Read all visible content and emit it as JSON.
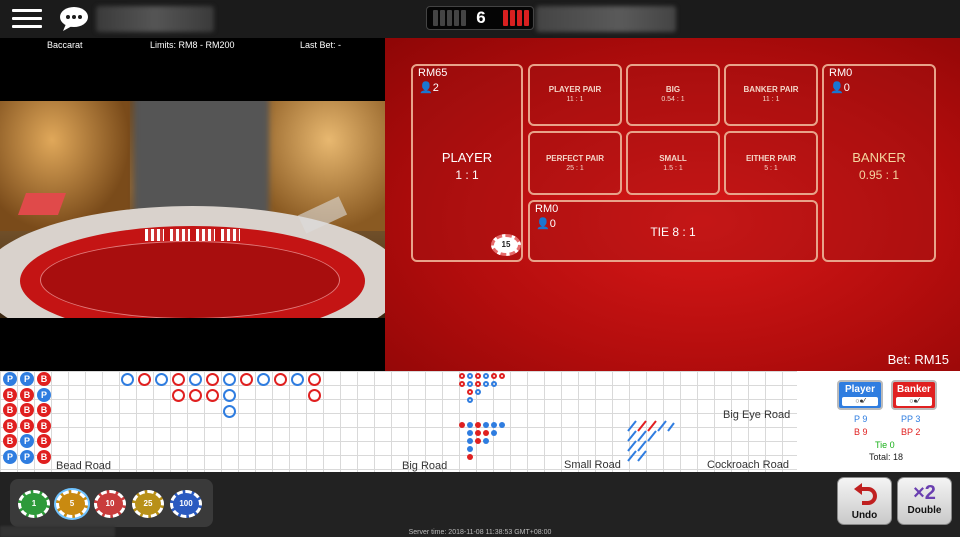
{
  "header": {
    "menu_icon": "hamburger-menu-icon",
    "chat_icon": "chat-bubble-icon",
    "shoe_count": "6"
  },
  "video": {
    "game_name": "Baccarat",
    "limits": "Limits: RM8 - RM200",
    "last_bet": "Last Bet: -"
  },
  "bet_table": {
    "player": {
      "amount": "RM65",
      "players": "2",
      "label": "PLAYER",
      "odds": "1 : 1",
      "chip": "15"
    },
    "banker": {
      "amount": "RM0",
      "players": "0",
      "label": "BANKER",
      "odds": "0.95 : 1"
    },
    "tie": {
      "amount": "RM0",
      "players": "0",
      "label": "TIE 8 : 1"
    },
    "side_bets": [
      {
        "label": "PLAYER PAIR",
        "odds": "11 : 1"
      },
      {
        "label": "BIG",
        "odds": "0.54 : 1"
      },
      {
        "label": "BANKER PAIR",
        "odds": "11 : 1"
      },
      {
        "label": "PERFECT PAIR",
        "odds": "25 : 1"
      },
      {
        "label": "SMALL",
        "odds": "1.5 : 1"
      },
      {
        "label": "EITHER PAIR",
        "odds": "5 : 1"
      }
    ],
    "bet_total": "Bet: RM15"
  },
  "roads": {
    "bead_label": "Bead Road",
    "big_label": "Big Road",
    "small_label": "Small Road",
    "big_eye_label": "Big Eye Road",
    "cockroach_label": "Cockroach Road",
    "bead_columns": [
      [
        "P",
        "B",
        "B",
        "B",
        "B",
        "P"
      ],
      [
        "P",
        "B",
        "B",
        "B",
        "P",
        "P"
      ],
      [
        "B",
        "P",
        "B",
        "B",
        "B",
        "B"
      ]
    ]
  },
  "stats": {
    "player_button": "Player",
    "banker_button": "Banker",
    "player_count": "P 9",
    "banker_count": "B 9",
    "player_pair": "PP 3",
    "banker_pair": "BP 2",
    "tie": "Tie 0",
    "total": "Total: 18"
  },
  "chips": [
    "1",
    "5",
    "10",
    "25",
    "100"
  ],
  "actions": {
    "undo_label": "Undo",
    "double_label": "Double",
    "double_icon_text": "×2"
  },
  "server_time": "Server time: 2018-11-08 11:38:53 GMT+08:00",
  "colors": {
    "player_blue": "#2f7de0",
    "banker_red": "#e02020",
    "table_red": "#c41414"
  }
}
